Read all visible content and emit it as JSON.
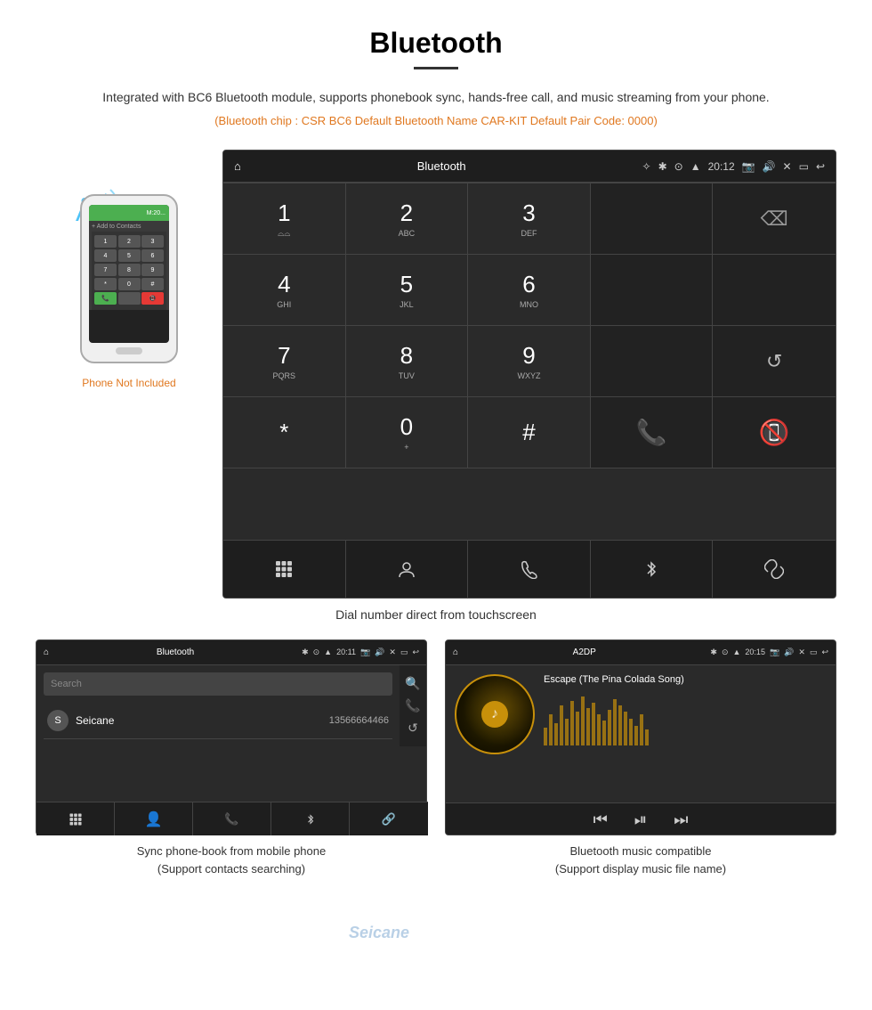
{
  "header": {
    "title": "Bluetooth",
    "underline": true,
    "description": "Integrated with BC6 Bluetooth module, supports phonebook sync, hands-free call, and music streaming from your phone.",
    "bt_info": "(Bluetooth chip : CSR BC6   Default Bluetooth Name CAR-KIT    Default Pair Code: 0000)"
  },
  "phone_note": "Phone Not Included",
  "dial_screen": {
    "title": "Bluetooth",
    "time": "20:12",
    "keys": [
      {
        "num": "1",
        "sub": "⌓⌓"
      },
      {
        "num": "2",
        "sub": "ABC"
      },
      {
        "num": "3",
        "sub": "DEF"
      },
      {
        "num": "",
        "sub": ""
      },
      {
        "num": "⌫",
        "sub": ""
      },
      {
        "num": "4",
        "sub": "GHI"
      },
      {
        "num": "5",
        "sub": "JKL"
      },
      {
        "num": "6",
        "sub": "MNO"
      },
      {
        "num": "",
        "sub": ""
      },
      {
        "num": "",
        "sub": ""
      },
      {
        "num": "7",
        "sub": "PQRS"
      },
      {
        "num": "8",
        "sub": "TUV"
      },
      {
        "num": "9",
        "sub": "WXYZ"
      },
      {
        "num": "",
        "sub": ""
      },
      {
        "num": "↺",
        "sub": ""
      },
      {
        "num": "*",
        "sub": ""
      },
      {
        "num": "0",
        "sub": "+"
      },
      {
        "num": "#",
        "sub": ""
      },
      {
        "num": "📞",
        "sub": ""
      },
      {
        "num": "📵",
        "sub": ""
      }
    ],
    "caption": "Dial number direct from touchscreen"
  },
  "phonebook_screen": {
    "title": "Bluetooth",
    "time": "20:11",
    "search_placeholder": "Search",
    "contacts": [
      {
        "initial": "S",
        "name": "Seicane",
        "number": "13566664466"
      }
    ],
    "caption_line1": "Sync phone-book from mobile phone",
    "caption_line2": "(Support contacts searching)"
  },
  "music_screen": {
    "title": "A2DP",
    "time": "20:15",
    "song_title": "Escape (The Pina Colada Song)",
    "caption_line1": "Bluetooth music compatible",
    "caption_line2": "(Support display music file name)"
  },
  "watermark": "Seicane"
}
